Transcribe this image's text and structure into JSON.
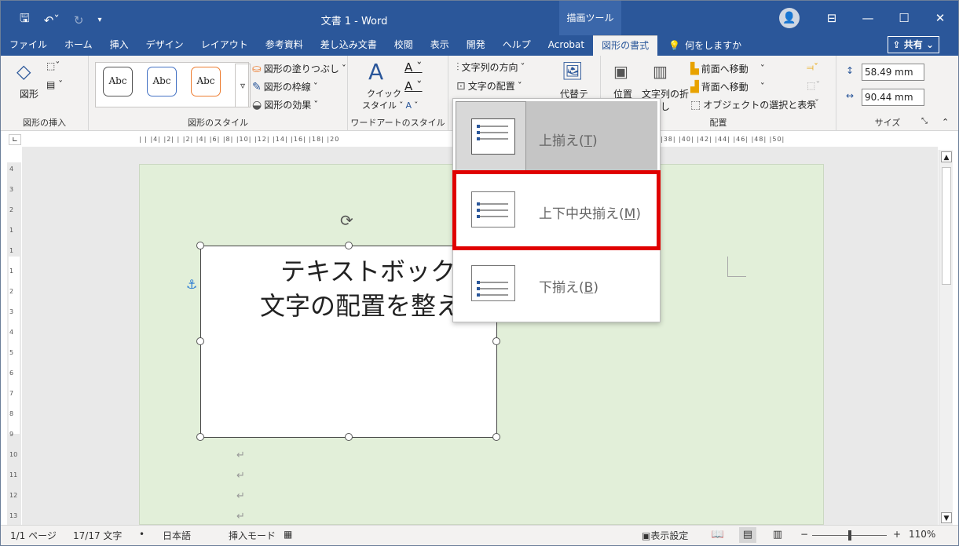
{
  "titlebar": {
    "doc_title": "文書 1 - Word",
    "context_header": "描画ツール",
    "qat": [
      "save-icon",
      "undo-icon",
      "redo-icon",
      "qat-menu-icon"
    ],
    "controls": [
      "account-icon",
      "ribbon-display-icon",
      "minimize",
      "maximize",
      "close"
    ]
  },
  "tabs": [
    {
      "label": "ファイル"
    },
    {
      "label": "ホーム"
    },
    {
      "label": "挿入"
    },
    {
      "label": "デザイン"
    },
    {
      "label": "レイアウト"
    },
    {
      "label": "参考資料"
    },
    {
      "label": "差し込み文書"
    },
    {
      "label": "校閲"
    },
    {
      "label": "表示"
    },
    {
      "label": "開発"
    },
    {
      "label": "ヘルプ"
    },
    {
      "label": "Acrobat"
    },
    {
      "label": "図形の書式",
      "active": true
    }
  ],
  "tellme": "何をしますか",
  "share": "共有",
  "ribbon": {
    "insert_shapes": {
      "label": "図形の挿入",
      "shape_btn": "図形"
    },
    "shape_styles": {
      "label": "図形のスタイル",
      "gallery": [
        "Abc",
        "Abc",
        "Abc"
      ],
      "fill": "図形の塗りつぶし",
      "outline": "図形の枠線",
      "effect": "図形の効果"
    },
    "wordart": {
      "label": "ワードアートのスタイル",
      "quick": "クイック",
      "quick2": "スタイル"
    },
    "text": {
      "direction": "文字列の方向",
      "align": "文字の配置"
    },
    "accessibility": {
      "alt": "代替テ"
    },
    "arrange": {
      "label": "配置",
      "position": "位置",
      "wrap": "文字列の折",
      "wrap2": "し",
      "forward": "前面へ移動",
      "backward": "背面へ移動",
      "selection": "オブジェクトの選択と表示"
    },
    "size": {
      "label": "サイズ",
      "height": "58.49 mm",
      "width": "90.44 mm"
    }
  },
  "ruler": {
    "horizontal": "| | |4| |2| | |2| |4| |6| |8| |10| |12| |14| |16| |18| |20",
    "horizontal_right": "|38| |40| |42| |44| |46| |48| |50|",
    "vertical": [
      "4",
      "3",
      "2",
      "1",
      "1",
      "1",
      "2",
      "3",
      "4",
      "5",
      "6",
      "7",
      "8",
      "9",
      "10",
      "11",
      "12",
      "13"
    ]
  },
  "document": {
    "textbox_line1": "テキストボックス",
    "textbox_line2": "文字の配置を整え",
    "para_mark": "↵"
  },
  "dropdown": {
    "items": [
      {
        "label": "上揃え(",
        "key": "T",
        "close": ")"
      },
      {
        "label": "上下中央揃え(",
        "key": "M",
        "close": ")"
      },
      {
        "label": "下揃え(",
        "key": "B",
        "close": ")"
      }
    ]
  },
  "status": {
    "page": "1/1 ページ",
    "words": "17/17 文字",
    "language": "日本語",
    "mode": "挿入モード",
    "display": "表示設定",
    "zoom": "110%"
  },
  "colors": {
    "accent": "#2b579a",
    "highlight": "#e00000",
    "page": "#e2efd9"
  }
}
